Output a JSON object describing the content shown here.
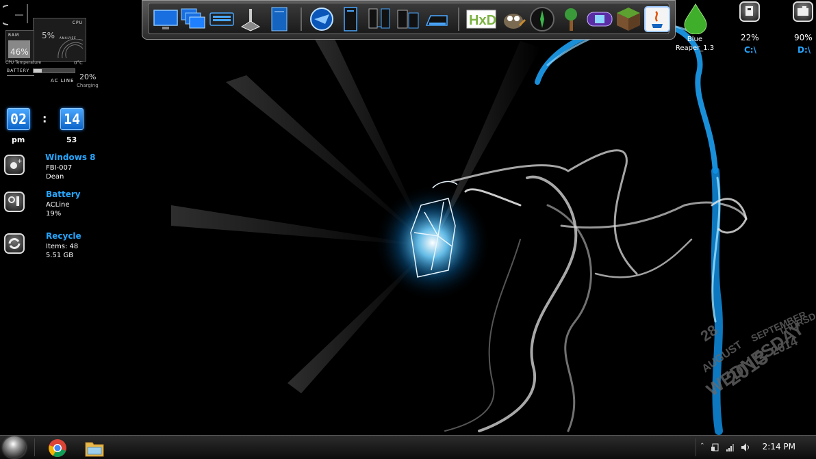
{
  "system_meter": {
    "cpu_label": "CPU",
    "ram_label": "RAM",
    "cpu_percent": "5%",
    "ram_percent": "46%",
    "analyse_label": "ANALYSE",
    "cpu_temp_label": "CPU Temperature",
    "cpu_temp_value": "0°C",
    "battery_label": "BATTERY",
    "battery_percent": "20%",
    "ac_line_label": "AC LINE",
    "charging_label": "Charging"
  },
  "clock": {
    "hours": "02",
    "separator": ":",
    "minutes": "14",
    "ampm": "pm",
    "seconds": "53"
  },
  "info_widgets": [
    {
      "title": "Windows 8",
      "line1": "FBI-007",
      "line2": "Dean",
      "icon": "user-add-icon"
    },
    {
      "title": "Battery",
      "line1": "ACLine",
      "line2": "19%",
      "icon": "battery-icon"
    },
    {
      "title": "Recycle",
      "line1": "Items: 48",
      "line2": "5.51 GB",
      "icon": "recycle-icon"
    }
  ],
  "dock": {
    "items": [
      {
        "icon": "monitor-icon"
      },
      {
        "icon": "multi-window-icon"
      },
      {
        "icon": "keyboard-icon"
      },
      {
        "icon": "joystick-icon"
      },
      {
        "icon": "notebook-icon"
      },
      {
        "icon": "browser-globe-icon"
      },
      {
        "icon": "computer-tower-icon"
      },
      {
        "icon": "network-computers-icon"
      },
      {
        "icon": "devices-icon"
      },
      {
        "icon": "scanner-icon"
      },
      {
        "icon": "hxd-hex-editor-icon",
        "text": "HxD"
      },
      {
        "icon": "gimp-icon"
      },
      {
        "icon": "compass-icon"
      },
      {
        "icon": "terraria-tree-icon"
      },
      {
        "icon": "gameboy-advance-icon"
      },
      {
        "icon": "minecraft-block-icon"
      },
      {
        "icon": "java-icon"
      }
    ]
  },
  "desktop_shortcut": {
    "label_line1": "Blue",
    "label_line2": "Reaper_1.3",
    "icon": "water-drop-icon"
  },
  "drives": [
    {
      "percent": "22%",
      "name": "C:\\",
      "icon": "drive-c-icon"
    },
    {
      "percent": "90%",
      "name": "D:\\",
      "icon": "drive-d-icon"
    }
  ],
  "wallpaper": {
    "calendar_text": [
      "WEDNESDAY",
      "AUGUST",
      "2013",
      "28",
      "SEPTEMBER",
      "THURSDAY",
      "2014"
    ],
    "accent_color": "#1ea8ff"
  },
  "taskbar": {
    "pinned": [
      {
        "icon": "start-orb-icon"
      },
      {
        "icon": "chrome-icon"
      },
      {
        "icon": "file-explorer-icon"
      }
    ],
    "tray_icons": [
      "show-hidden-icons-icon",
      "network-icon",
      "signal-icon",
      "volume-icon"
    ],
    "time": "2:14 PM"
  }
}
